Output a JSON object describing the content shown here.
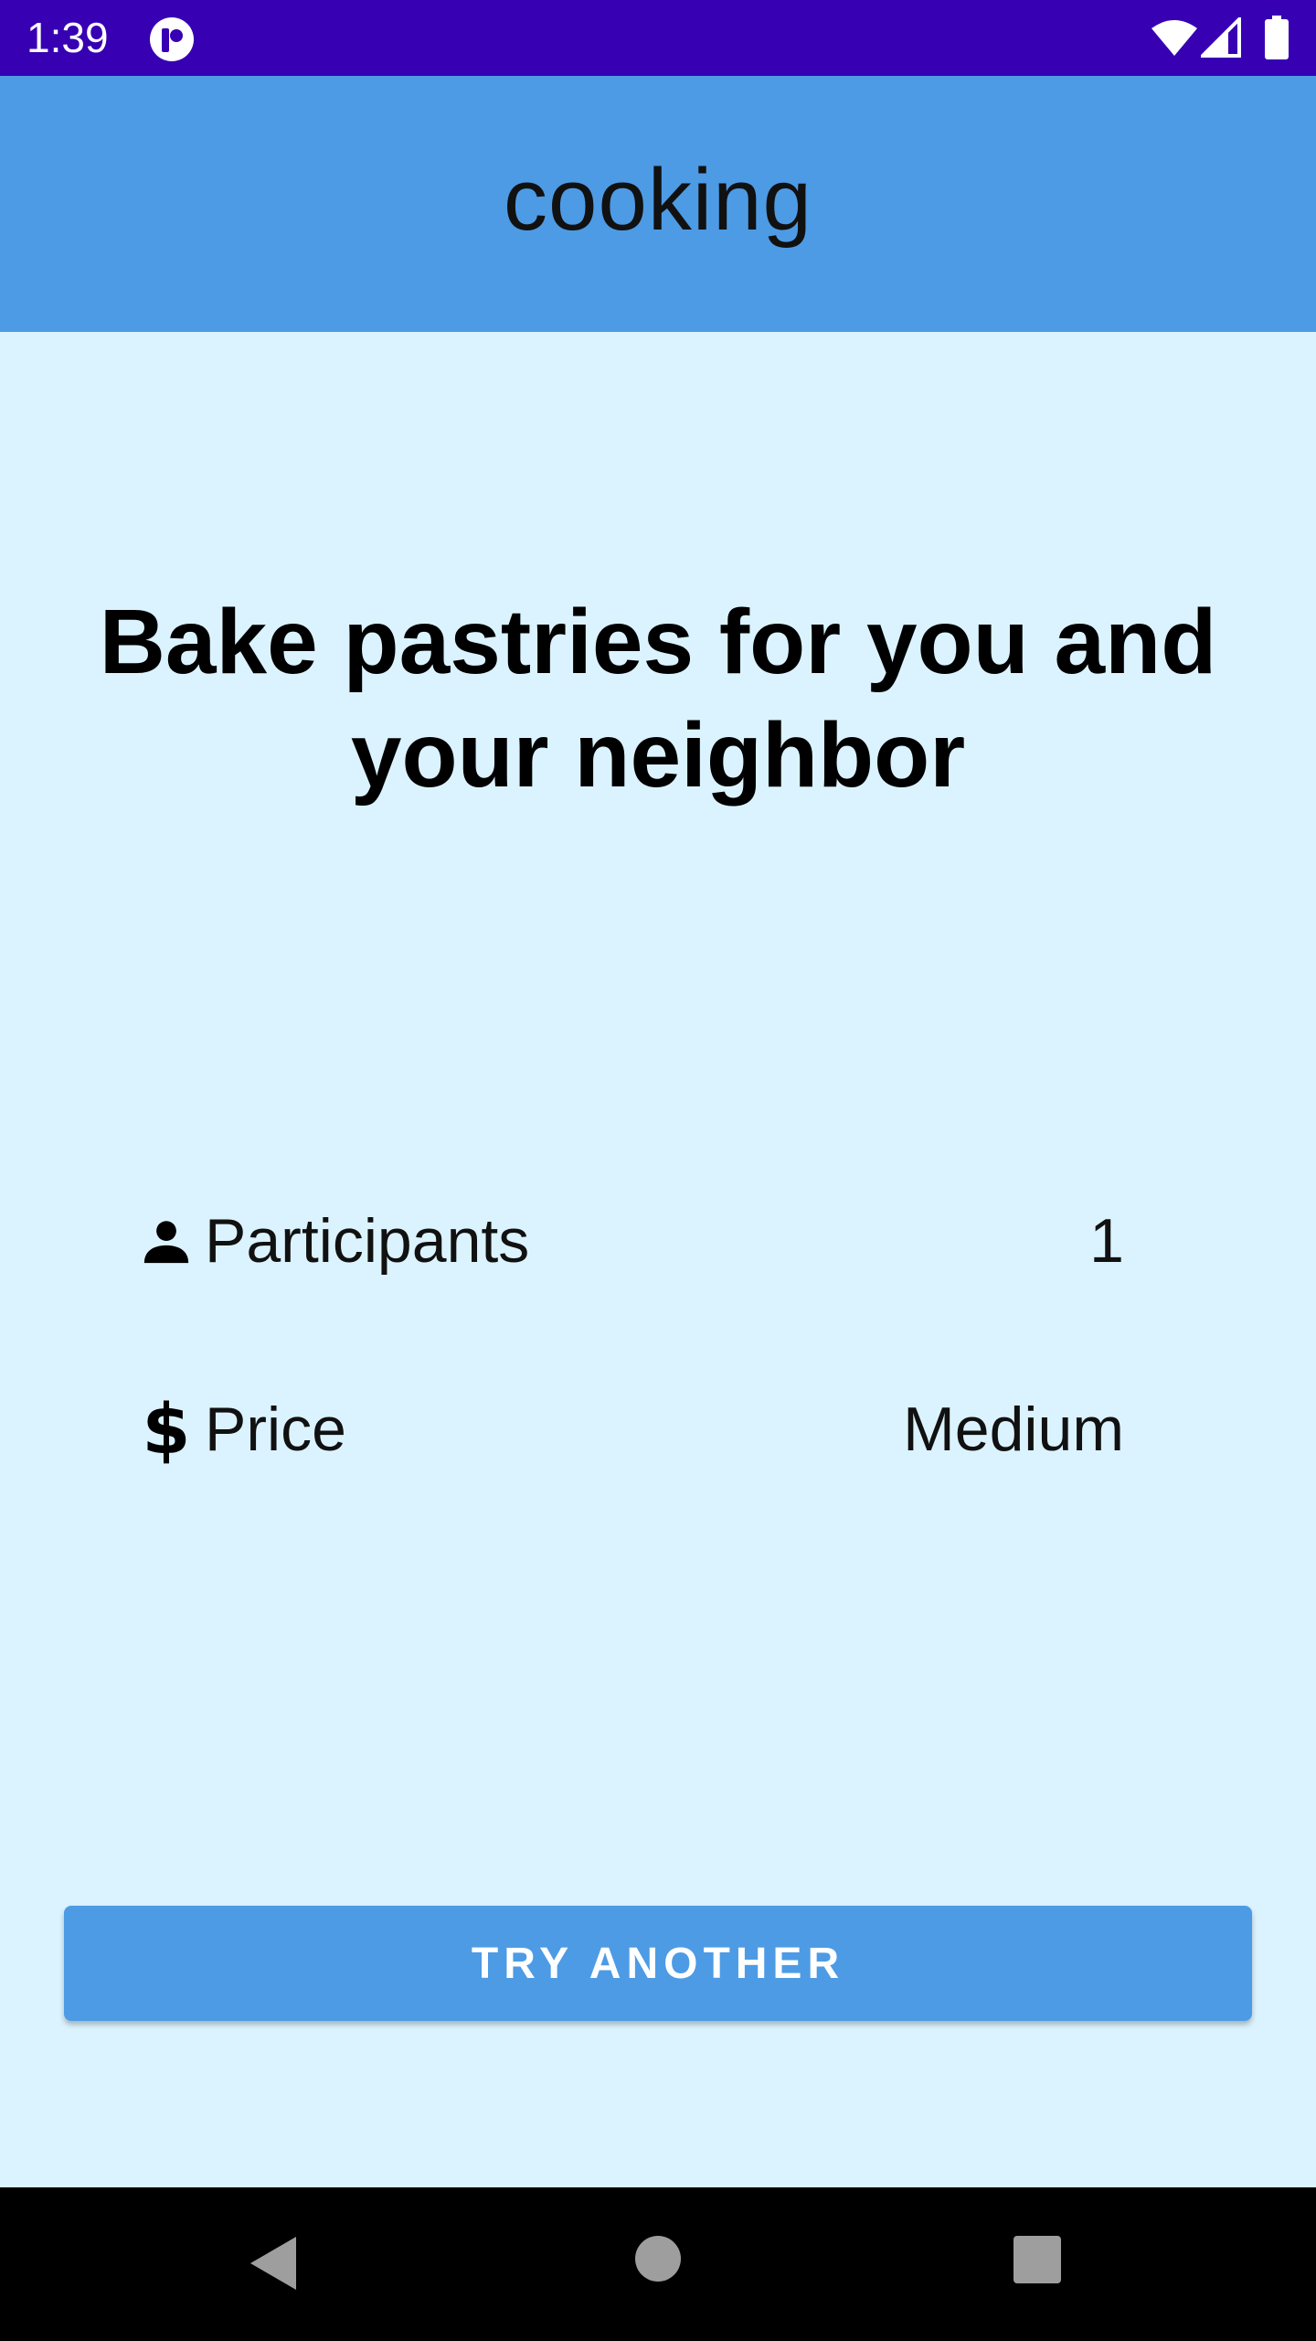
{
  "status_bar": {
    "time": "1:39",
    "background": "#3700b3"
  },
  "app_bar": {
    "title": "cooking",
    "background": "#4d9be5"
  },
  "activity": {
    "title": "Bake pastries for you and your neighbor"
  },
  "details": {
    "participants": {
      "icon": "person-icon",
      "label": "Participants",
      "value": "1"
    },
    "price": {
      "icon": "dollar-icon",
      "glyph": "$",
      "label": "Price",
      "value": "Medium"
    }
  },
  "actions": {
    "try_another_label": "TRY ANOTHER"
  },
  "colors": {
    "page_background": "#dbf3fe",
    "accent": "#4d9be5",
    "status_bar": "#3700b3",
    "nav_bar": "#000000"
  },
  "nav_bar": {
    "back_icon": "back-icon",
    "home_icon": "home-icon",
    "recents_icon": "recents-icon"
  }
}
